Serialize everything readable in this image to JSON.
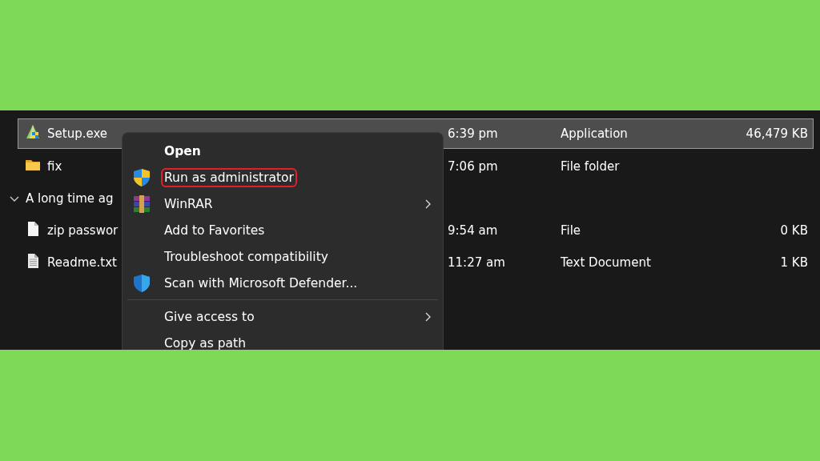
{
  "files": [
    {
      "kind": "exe",
      "name": "Setup.exe",
      "modified": "6:39 pm",
      "type": "Application",
      "size": "46,479 KB",
      "selected": true
    },
    {
      "kind": "folder",
      "name": "fix",
      "modified": "7:06 pm",
      "type": "File folder",
      "selected": false
    },
    {
      "kind": "group",
      "name": "A long time ag",
      "expanded": true
    },
    {
      "kind": "file",
      "name": "zip passwor",
      "modified": "9:54 am",
      "type": "File",
      "size": "0 KB",
      "selected": false
    },
    {
      "kind": "text",
      "name": "Readme.txt",
      "modified": "11:27 am",
      "type": "Text Document",
      "size": "1 KB",
      "selected": false
    }
  ],
  "context_menu": [
    {
      "kind": "item",
      "label": "Open",
      "default": true,
      "highlighted": false
    },
    {
      "kind": "uac",
      "label": "Run as administrator",
      "highlighted": true
    },
    {
      "kind": "archive",
      "label": "WinRAR",
      "submenu": true,
      "highlighted": false
    },
    {
      "kind": "item",
      "label": "Add to Favorites",
      "highlighted": false
    },
    {
      "kind": "item",
      "label": "Troubleshoot compatibility",
      "highlighted": false
    },
    {
      "kind": "defender",
      "label": "Scan with Microsoft Defender...",
      "highlighted": false
    },
    {
      "kind": "separator"
    },
    {
      "kind": "item",
      "label": "Give access to",
      "submenu": true,
      "highlighted": false
    },
    {
      "kind": "item",
      "label": "Copy as path",
      "highlighted": false
    }
  ]
}
